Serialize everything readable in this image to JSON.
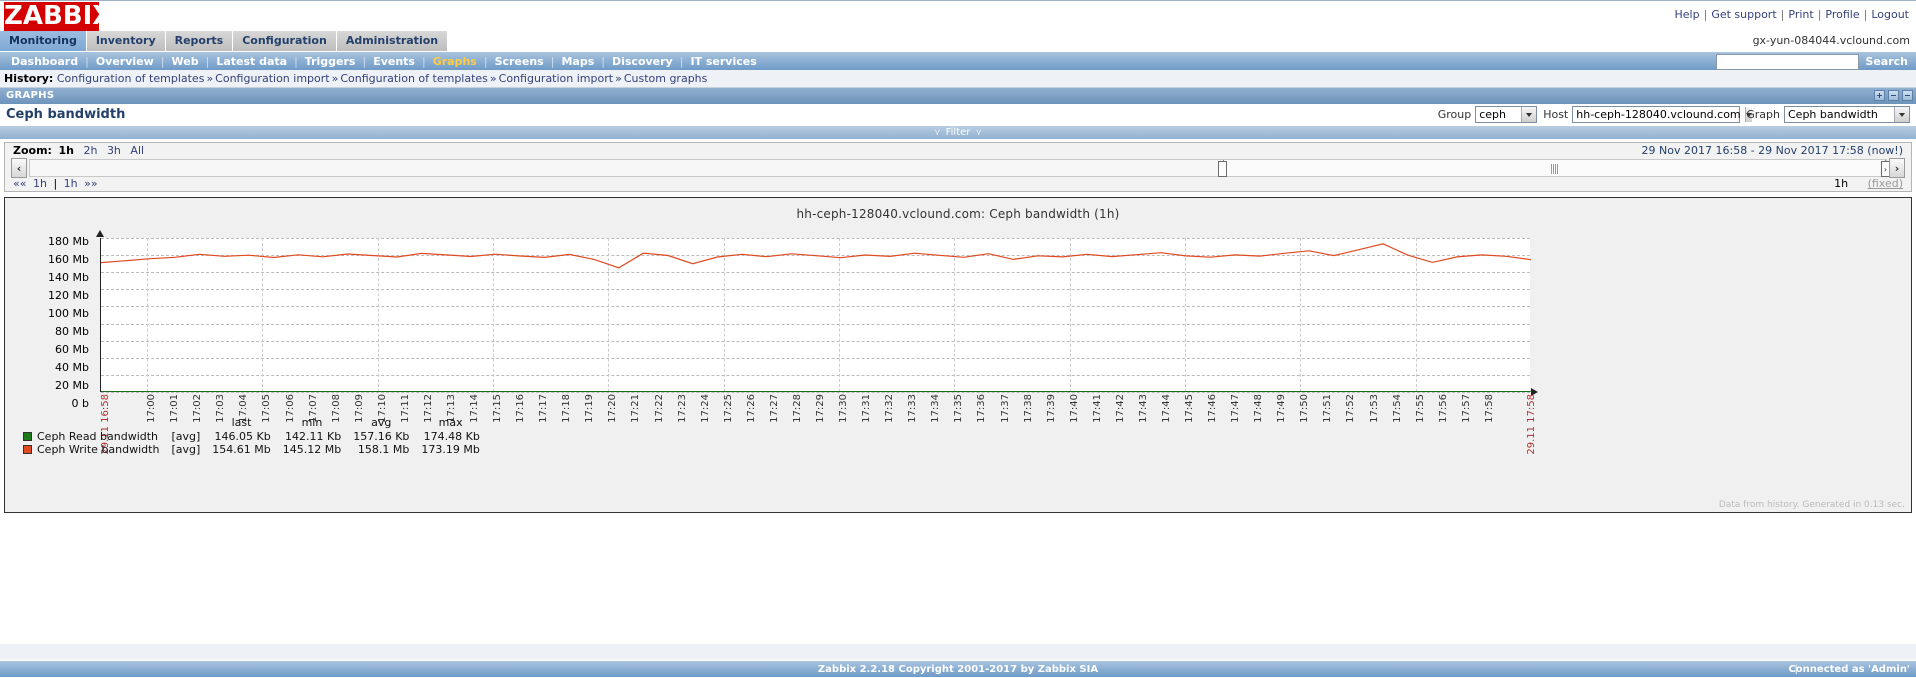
{
  "brand": {
    "logo_text": "ZABBIX",
    "logo_color": "#d40000"
  },
  "top_links": [
    "Help",
    "Get support",
    "Print",
    "Profile",
    "Logout"
  ],
  "server_label": "gx-yun-084044.vclound.com",
  "menu_primary": [
    {
      "label": "Monitoring",
      "active": true
    },
    {
      "label": "Inventory",
      "active": false
    },
    {
      "label": "Reports",
      "active": false
    },
    {
      "label": "Configuration",
      "active": false
    },
    {
      "label": "Administration",
      "active": false
    }
  ],
  "menu_secondary": [
    {
      "label": "Dashboard",
      "active": false
    },
    {
      "label": "Overview",
      "active": false
    },
    {
      "label": "Web",
      "active": false
    },
    {
      "label": "Latest data",
      "active": false
    },
    {
      "label": "Triggers",
      "active": false
    },
    {
      "label": "Events",
      "active": false
    },
    {
      "label": "Graphs",
      "active": true
    },
    {
      "label": "Screens",
      "active": false
    },
    {
      "label": "Maps",
      "active": false
    },
    {
      "label": "Discovery",
      "active": false
    },
    {
      "label": "IT services",
      "active": false
    }
  ],
  "search": {
    "value": "",
    "placeholder": "",
    "button_label": "Search"
  },
  "history": {
    "label": "History:",
    "items": [
      "Configuration of templates",
      "Configuration import",
      "Configuration of templates",
      "Configuration import",
      "Custom graphs"
    ],
    "separator": "»"
  },
  "page_header": "GRAPHS",
  "page_title": "Ceph bandwidth",
  "selectors": {
    "group": {
      "label": "Group",
      "value": "ceph"
    },
    "host": {
      "label": "Host",
      "value": "hh-ceph-128040.vclound.com"
    },
    "graph": {
      "label": "Graph",
      "value": "Ceph bandwidth"
    }
  },
  "filter_bar": {
    "label": "Filter",
    "chevron": "≈"
  },
  "time_controls": {
    "zoom_label": "Zoom:",
    "zoom_options": [
      {
        "label": "1h",
        "active": true
      },
      {
        "label": "2h",
        "active": false
      },
      {
        "label": "3h",
        "active": false
      },
      {
        "label": "All",
        "active": false
      }
    ],
    "date_range": "29 Nov 2017 16:58  -  29 Nov 2017 17:58 (now!)",
    "scroll_left": "‹",
    "scroll_right": "›",
    "nav_prev_all": "««",
    "nav_prev": "1h",
    "nav_divider": "|",
    "nav_next": "1h",
    "nav_next_all": "»»",
    "period": "1h",
    "fixed_label": "(fixed)"
  },
  "chart_data": {
    "type": "line",
    "title": "hh-ceph-128040.vclound.com: Ceph bandwidth (1h)",
    "xlabel": "",
    "ylabel": "",
    "ylim": [
      0,
      180
    ],
    "yticks": [
      "180 Mb",
      "160 Mb",
      "140 Mb",
      "120 Mb",
      "100 Mb",
      "80 Mb",
      "60 Mb",
      "40 Mb",
      "20 Mb",
      "0 b"
    ],
    "grid": true,
    "legend_position": "bottom",
    "x_start_label": "29.11 16:58",
    "x_end_label": "29.11 17:58",
    "xticks": [
      "17:00",
      "17:01",
      "17:02",
      "17:03",
      "17:04",
      "17:05",
      "17:06",
      "17:07",
      "17:08",
      "17:09",
      "17:10",
      "17:11",
      "17:12",
      "17:13",
      "17:14",
      "17:15",
      "17:16",
      "17:17",
      "17:18",
      "17:19",
      "17:20",
      "17:21",
      "17:22",
      "17:23",
      "17:24",
      "17:25",
      "17:26",
      "17:27",
      "17:28",
      "17:29",
      "17:30",
      "17:31",
      "17:32",
      "17:33",
      "17:34",
      "17:35",
      "17:36",
      "17:37",
      "17:38",
      "17:39",
      "17:40",
      "17:41",
      "17:42",
      "17:43",
      "17:44",
      "17:45",
      "17:46",
      "17:47",
      "17:48",
      "17:49",
      "17:50",
      "17:51",
      "17:52",
      "17:53",
      "17:54",
      "17:55",
      "17:56",
      "17:57",
      "17:58"
    ],
    "series": [
      {
        "name": "Ceph Read bandwidth",
        "color": "#1a7a1a",
        "aggregation": "[avg]",
        "unit": "Kb",
        "values": [
          0.146,
          0.15,
          0.152,
          0.148,
          0.155,
          0.149,
          0.147,
          0.152,
          0.15,
          0.146,
          0.151,
          0.148,
          0.153,
          0.149,
          0.147,
          0.152,
          0.155,
          0.15,
          0.148,
          0.151,
          0.149,
          0.147,
          0.153,
          0.15,
          0.152,
          0.148,
          0.146,
          0.151,
          0.149,
          0.154,
          0.15,
          0.147,
          0.152,
          0.148,
          0.151,
          0.149,
          0.153,
          0.15,
          0.147,
          0.152,
          0.148,
          0.15,
          0.155,
          0.149,
          0.146,
          0.151,
          0.153,
          0.148,
          0.15,
          0.152,
          0.147,
          0.149,
          0.151,
          0.15,
          0.148,
          0.153,
          0.146,
          0.15,
          0.146
        ]
      },
      {
        "name": "Ceph Write bandwidth",
        "color": "#e04a20",
        "aggregation": "[avg]",
        "unit": "Mb",
        "values": [
          151.2,
          153.5,
          155.8,
          157.4,
          161.0,
          158.6,
          159.9,
          157.2,
          160.4,
          158.0,
          161.3,
          159.5,
          157.8,
          162.0,
          160.2,
          158.4,
          161.1,
          159.0,
          157.3,
          160.8,
          155.0,
          145.2,
          162.4,
          159.6,
          150.0,
          157.8,
          160.9,
          158.2,
          161.5,
          159.3,
          157.0,
          160.1,
          158.5,
          162.2,
          159.8,
          157.4,
          161.6,
          155.0,
          159.2,
          157.9,
          161.0,
          158.3,
          160.5,
          162.8,
          159.1,
          157.6,
          160.3,
          158.8,
          162.1,
          165.0,
          159.4,
          166.2,
          173.2,
          160.0,
          151.5,
          157.9,
          160.2,
          158.6,
          154.6
        ]
      }
    ],
    "summary_headers": [
      "last",
      "min",
      "avg",
      "max"
    ],
    "summary_rows": [
      {
        "name": "Ceph Read bandwidth",
        "color": "#1a7a1a",
        "aggregation": "[avg]",
        "last": "146.05 Kb",
        "min": "142.11 Kb",
        "avg": "157.16 Kb",
        "max": "174.48 Kb"
      },
      {
        "name": "Ceph Write bandwidth",
        "color": "#e04a20",
        "aggregation": "[avg]",
        "last": "154.61 Mb",
        "min": "145.12 Mb",
        "avg": "158.1 Mb",
        "max": "173.19 Mb"
      }
    ]
  },
  "graph_note": "Data from history. Generated in 0.13 sec.",
  "footer": {
    "copyright": "Zabbix 2.2.18 Copyright 2001-2017 by Zabbix SIA",
    "connected_as": "Connected as 'Admin'",
    "divider": "|"
  }
}
